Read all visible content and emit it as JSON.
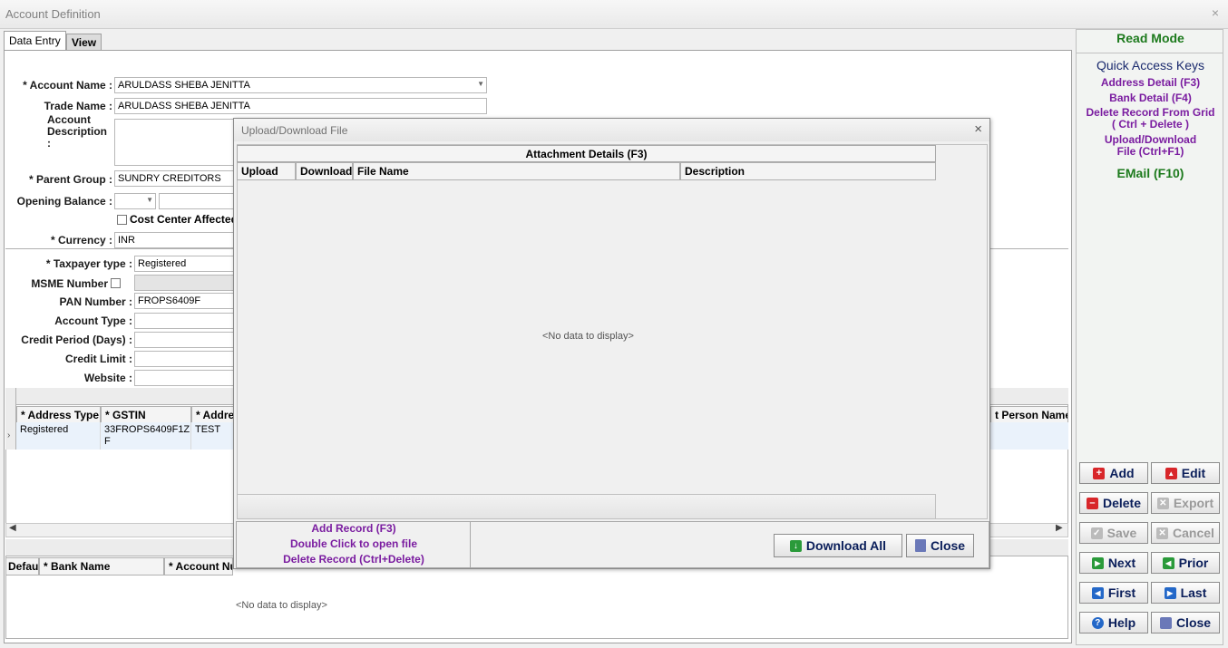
{
  "window": {
    "title": "Account Definition",
    "close": "×"
  },
  "tabs": [
    {
      "label": "Data Entry"
    },
    {
      "label": "View"
    }
  ],
  "form": {
    "account_name_label": "* Account Name :",
    "account_name": "ARULDASS SHEBA JENITTA",
    "trade_name_label": "Trade Name :",
    "trade_name": "ARULDASS SHEBA JENITTA",
    "account_description_label": "Account Description :",
    "parent_group_label": "* Parent Group :",
    "parent_group": "SUNDRY CREDITORS",
    "opening_balance_label": "Opening Balance :",
    "cost_center_label": "Cost Center Affected",
    "currency_label": "* Currency :",
    "currency": "INR",
    "taxpayer_type_label": "* Taxpayer type :",
    "taxpayer_type": "Registered",
    "msme_label": "MSME Number",
    "pan_label": "PAN Number :",
    "pan": "FROPS6409F",
    "account_type_label": "Account Type :",
    "credit_period_label": "Credit Period (Days) :",
    "credit_limit_label": "Credit Limit :",
    "website_label": "Website :"
  },
  "address_grid": {
    "columns": [
      "* Address Type",
      "* GSTIN",
      "* Addre",
      "t Person Name"
    ],
    "row": {
      "address_type": "Registered",
      "gstin": "33FROPS6409F1Z F",
      "address": "TEST"
    }
  },
  "bank_grid": {
    "columns": [
      "Defau",
      "* Bank Name",
      "* Account Nu"
    ],
    "empty": "<No data to display>"
  },
  "right_panel": {
    "mode": "Read Mode",
    "quick_access_title": "Quick Access Keys",
    "keys": [
      "Address Detail (F3)",
      "Bank Detail (F4)",
      "Delete Record From Grid ( Ctrl + Delete )",
      "Upload/Download File (Ctrl+F1)"
    ],
    "email": "EMail (F10)",
    "buttons": {
      "add": "Add",
      "edit": "Edit",
      "delete": "Delete",
      "export": "Export",
      "save": "Save",
      "cancel": "Cancel",
      "next": "Next",
      "prior": "Prior",
      "first": "First",
      "last": "Last",
      "help": "Help",
      "close": "Close"
    }
  },
  "modal": {
    "title": "Upload/Download File",
    "close": "×",
    "group_header": "Attachment Details (F3)",
    "columns": [
      "Upload",
      "Download",
      "File Name",
      "Description"
    ],
    "empty": "<No data to display>",
    "hints": [
      "Add Record (F3)",
      "Double Click to open file",
      "Delete Record (Ctrl+Delete)"
    ],
    "download_all": "Download All",
    "close_button": "Close"
  },
  "colors": {
    "accent_purple": "#7a1ca0",
    "accent_green": "#1d7a1d",
    "navy": "#1a2a6e"
  }
}
